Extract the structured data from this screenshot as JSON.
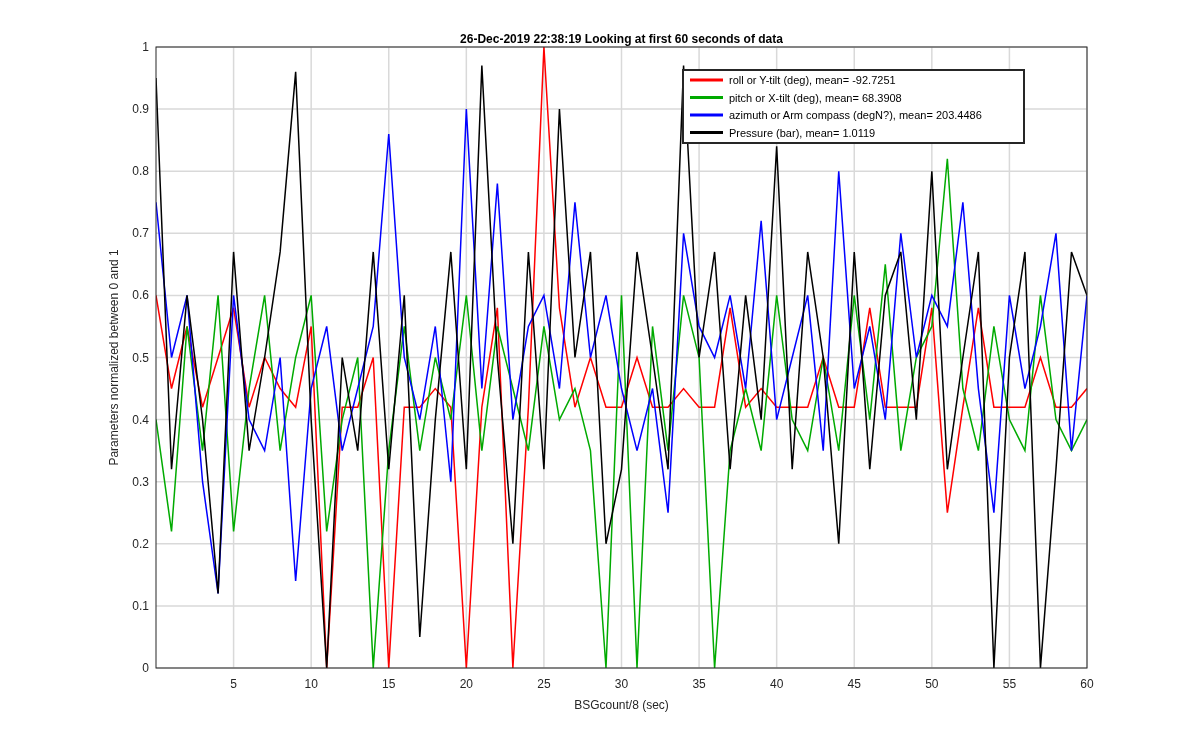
{
  "chart_data": {
    "type": "line",
    "title": "26-Dec-2019 22:38:19 Looking at first 60 seconds of data",
    "xlabel": "BSGcount/8 (sec)",
    "ylabel": "Parameters normalized between 0 and 1",
    "x": [
      0,
      1,
      2,
      3,
      4,
      5,
      6,
      7,
      8,
      9,
      10,
      11,
      12,
      13,
      14,
      15,
      16,
      17,
      18,
      19,
      20,
      21,
      22,
      23,
      24,
      25,
      26,
      27,
      28,
      29,
      30,
      31,
      32,
      33,
      34,
      35,
      36,
      37,
      38,
      39,
      40,
      41,
      42,
      43,
      44,
      45,
      46,
      47,
      48,
      49,
      50,
      51,
      52,
      53,
      54,
      55,
      56,
      57,
      58,
      59,
      60
    ],
    "grid": true,
    "legend": true,
    "xlim": [
      0,
      60
    ],
    "ylim": [
      0,
      1
    ],
    "xticks": [
      5,
      10,
      15,
      20,
      25,
      30,
      35,
      40,
      45,
      50,
      55,
      60
    ],
    "yticks": [
      0,
      0.1,
      0.2,
      0.3,
      0.4,
      0.5,
      0.6,
      0.7,
      0.8,
      0.9,
      1
    ],
    "series": [
      {
        "name": "roll or Y-tilt (deg), mean= -92.7251",
        "color": "#ff0000",
        "values": [
          0.6,
          0.45,
          0.55,
          0.42,
          0.5,
          0.58,
          0.42,
          0.5,
          0.45,
          0.42,
          0.55,
          0.0,
          0.42,
          0.42,
          0.5,
          0.0,
          0.42,
          0.42,
          0.45,
          0.42,
          0.0,
          0.42,
          0.58,
          0.0,
          0.42,
          1.0,
          0.58,
          0.42,
          0.5,
          0.42,
          0.42,
          0.5,
          0.42,
          0.42,
          0.45,
          0.42,
          0.42,
          0.58,
          0.42,
          0.45,
          0.42,
          0.42,
          0.42,
          0.5,
          0.42,
          0.42,
          0.58,
          0.42,
          0.42,
          0.42,
          0.58,
          0.25,
          0.42,
          0.58,
          0.42,
          0.42,
          0.42,
          0.5,
          0.42,
          0.42,
          0.45
        ]
      },
      {
        "name": "pitch or X-tilt (deg), mean= 68.3908",
        "color": "#00aa00",
        "values": [
          0.4,
          0.22,
          0.55,
          0.35,
          0.6,
          0.22,
          0.45,
          0.6,
          0.35,
          0.5,
          0.6,
          0.22,
          0.4,
          0.5,
          0.0,
          0.35,
          0.55,
          0.35,
          0.5,
          0.4,
          0.6,
          0.35,
          0.55,
          0.45,
          0.35,
          0.55,
          0.4,
          0.45,
          0.35,
          0.0,
          0.6,
          0.0,
          0.55,
          0.35,
          0.6,
          0.5,
          0.0,
          0.35,
          0.45,
          0.35,
          0.6,
          0.4,
          0.35,
          0.5,
          0.35,
          0.6,
          0.4,
          0.65,
          0.35,
          0.5,
          0.55,
          0.82,
          0.45,
          0.35,
          0.55,
          0.4,
          0.35,
          0.6,
          0.4,
          0.35,
          0.4
        ]
      },
      {
        "name": "azimuth or Arm compass (degN?), mean= 203.4486",
        "color": "#0000ff",
        "values": [
          0.75,
          0.5,
          0.6,
          0.3,
          0.12,
          0.6,
          0.4,
          0.35,
          0.5,
          0.14,
          0.45,
          0.55,
          0.35,
          0.45,
          0.55,
          0.86,
          0.5,
          0.4,
          0.55,
          0.3,
          0.9,
          0.45,
          0.78,
          0.4,
          0.55,
          0.6,
          0.45,
          0.75,
          0.5,
          0.6,
          0.45,
          0.35,
          0.45,
          0.25,
          0.7,
          0.55,
          0.5,
          0.6,
          0.45,
          0.72,
          0.4,
          0.5,
          0.6,
          0.35,
          0.8,
          0.45,
          0.55,
          0.4,
          0.7,
          0.5,
          0.6,
          0.55,
          0.75,
          0.45,
          0.25,
          0.6,
          0.45,
          0.55,
          0.7,
          0.35,
          0.6
        ]
      },
      {
        "name": "Pressure (bar), mean= 1.0119",
        "color": "#000000",
        "values": [
          0.95,
          0.32,
          0.6,
          0.4,
          0.12,
          0.67,
          0.35,
          0.5,
          0.67,
          0.96,
          0.4,
          0.0,
          0.5,
          0.35,
          0.67,
          0.32,
          0.6,
          0.05,
          0.4,
          0.67,
          0.32,
          0.97,
          0.5,
          0.2,
          0.67,
          0.32,
          0.9,
          0.5,
          0.67,
          0.2,
          0.32,
          0.67,
          0.5,
          0.32,
          0.97,
          0.5,
          0.67,
          0.32,
          0.6,
          0.4,
          0.84,
          0.32,
          0.67,
          0.5,
          0.2,
          0.67,
          0.32,
          0.6,
          0.67,
          0.4,
          0.8,
          0.32,
          0.5,
          0.67,
          0.0,
          0.5,
          0.67,
          0.0,
          0.32,
          0.67,
          0.6
        ]
      }
    ]
  }
}
